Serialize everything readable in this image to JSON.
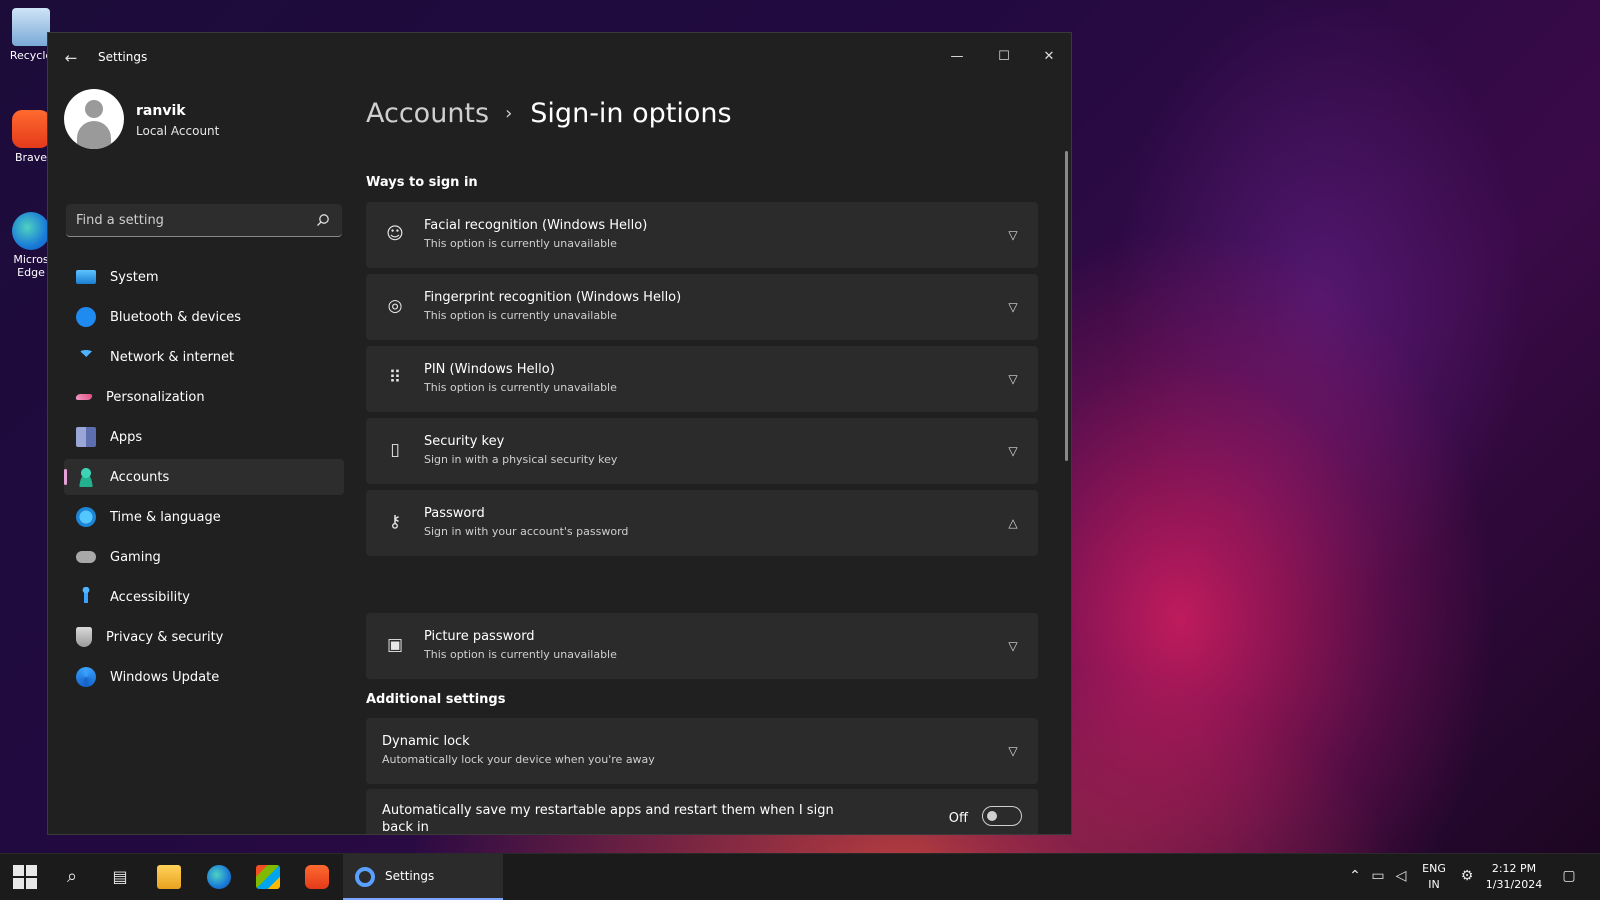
{
  "desktop": {
    "icons": [
      {
        "label": "Recycle"
      },
      {
        "label": "Brave"
      },
      {
        "label": "Micros Edge"
      }
    ]
  },
  "window": {
    "title": "Settings",
    "controls": {
      "minimize": "—",
      "maximize": "☐",
      "close": "✕"
    }
  },
  "user": {
    "name": "ranvik",
    "account_type": "Local Account"
  },
  "search": {
    "placeholder": "Find a setting"
  },
  "sidebar": {
    "items": [
      {
        "label": "System",
        "icon": "system-icon"
      },
      {
        "label": "Bluetooth & devices",
        "icon": "bluetooth-icon"
      },
      {
        "label": "Network & internet",
        "icon": "wifi-icon"
      },
      {
        "label": "Personalization",
        "icon": "brush-icon"
      },
      {
        "label": "Apps",
        "icon": "apps-icon"
      },
      {
        "label": "Accounts",
        "icon": "person-icon",
        "active": true
      },
      {
        "label": "Time & language",
        "icon": "globe-clock-icon"
      },
      {
        "label": "Gaming",
        "icon": "gamepad-icon"
      },
      {
        "label": "Accessibility",
        "icon": "accessibility-icon"
      },
      {
        "label": "Privacy & security",
        "icon": "shield-icon"
      },
      {
        "label": "Windows Update",
        "icon": "update-icon"
      }
    ]
  },
  "breadcrumb": {
    "parent": "Accounts",
    "separator": "›",
    "current": "Sign-in options"
  },
  "ways_to_sign_in": {
    "title": "Ways to sign in",
    "options": [
      {
        "title": "Facial recognition (Windows Hello)",
        "subtitle": "This option is currently unavailable",
        "icon": "face-icon",
        "glyph": "☺",
        "expanded": false
      },
      {
        "title": "Fingerprint recognition (Windows Hello)",
        "subtitle": "This option is currently unavailable",
        "icon": "fingerprint-icon",
        "glyph": "◎",
        "expanded": false
      },
      {
        "title": "PIN (Windows Hello)",
        "subtitle": "This option is currently unavailable",
        "icon": "keypad-icon",
        "glyph": "⠿",
        "expanded": false
      },
      {
        "title": "Security key",
        "subtitle": "Sign in with a physical security key",
        "icon": "usb-key-icon",
        "glyph": "▯",
        "expanded": false
      },
      {
        "title": "Password",
        "subtitle": "Sign in with your account's password",
        "icon": "key-icon",
        "glyph": "⚷",
        "expanded": true
      },
      {
        "title": "Picture password",
        "subtitle": "This option is currently unavailable",
        "icon": "picture-icon",
        "glyph": "▣",
        "expanded": false
      }
    ]
  },
  "additional_settings": {
    "title": "Additional settings",
    "dynamic_lock": {
      "title": "Dynamic lock",
      "subtitle": "Automatically lock your device when you're away"
    },
    "restart_apps": {
      "label": "Automatically save my restartable apps and restart them when I sign back in",
      "state": "Off"
    }
  },
  "taskbar": {
    "settings_label": "Settings",
    "language": {
      "line1": "ENG",
      "line2": "IN"
    },
    "clock": {
      "time": "2:12 PM",
      "date": "1/31/2024"
    }
  },
  "colors": {
    "accent": "#e8a0d8",
    "window_bg": "#202020",
    "card_bg": "#2b2b2b"
  }
}
